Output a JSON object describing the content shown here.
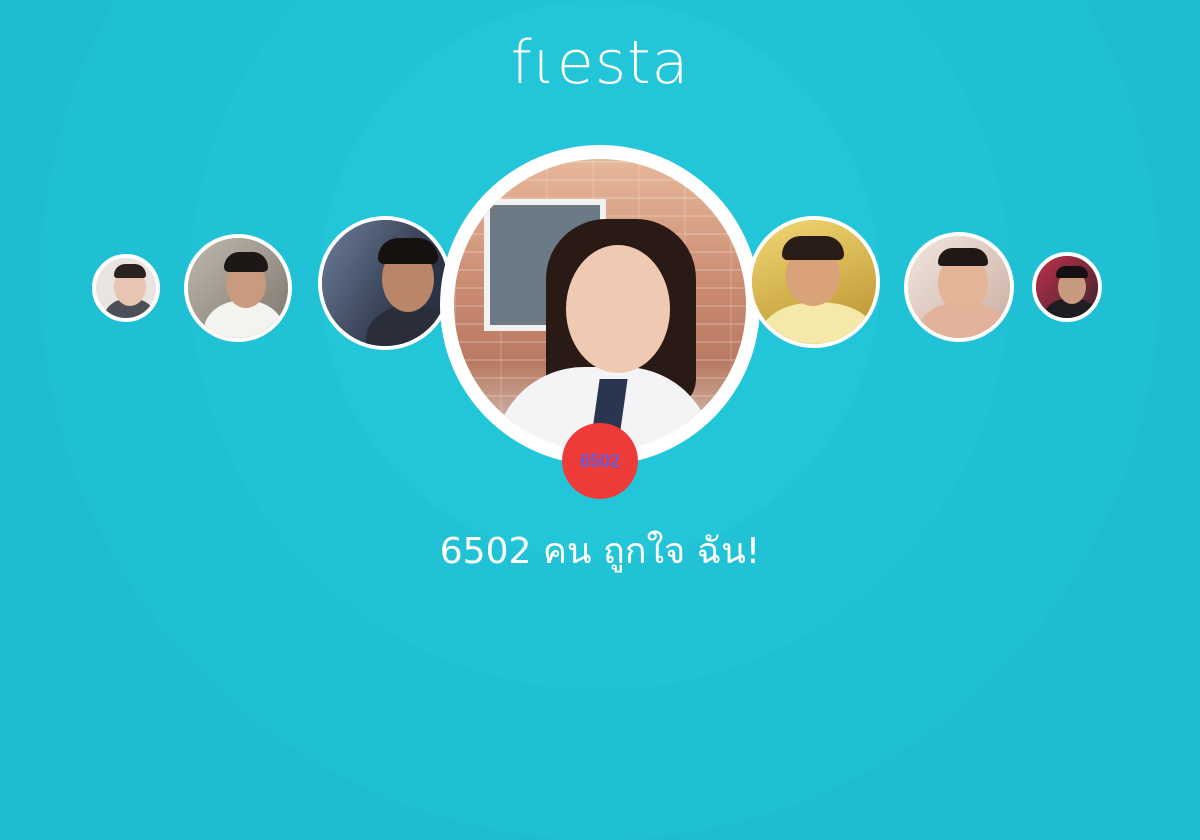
{
  "logo": {
    "text": "fιesta"
  },
  "colors": {
    "background": "#1fbcd2",
    "badge": "#ef3a3a",
    "badge_text": "#6b5bd2",
    "text": "#ffffff"
  },
  "featured_profile": {
    "like_count_badge": "6502"
  },
  "caption": {
    "text": "6502 คน ถูกใจ ฉัน!"
  },
  "profiles_left": [
    "profile-photo",
    "profile-photo",
    "profile-photo"
  ],
  "profiles_right": [
    "profile-photo",
    "profile-photo",
    "profile-photo"
  ]
}
